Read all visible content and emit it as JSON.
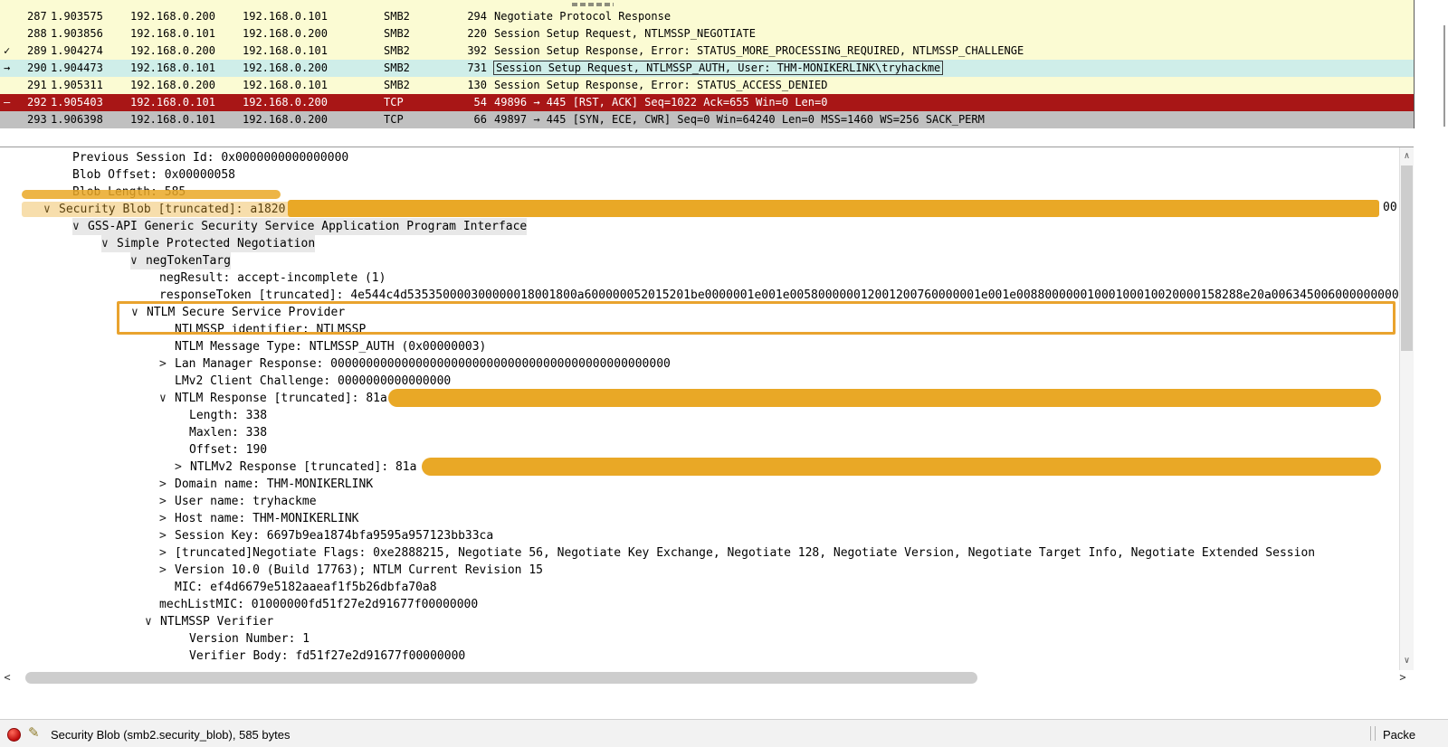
{
  "colors": {
    "row_yellow": "#fbfbd3",
    "row_teal": "#cfeee9",
    "row_red": "#a81616",
    "row_selected_gray": "#c0c0c0",
    "annotation_highlight": "#e9a826",
    "tree_highlight_gray": "#e8e8e8"
  },
  "icons": {
    "scroll_up": "∧",
    "scroll_down": "∨",
    "scroll_left": "<",
    "scroll_right": ">",
    "tree_expanded": "∨",
    "tree_collapsed": ">",
    "comment_pencil": "✎"
  },
  "packet_list": {
    "rows": [
      {
        "indicator": "",
        "no": "287",
        "time": "1.903575",
        "src": "192.168.0.200",
        "dst": "192.168.0.101",
        "proto": "SMB2",
        "len": "294",
        "info": "Negotiate Protocol Response",
        "style": "yellow",
        "info_boxed": false
      },
      {
        "indicator": "",
        "no": "288",
        "time": "1.903856",
        "src": "192.168.0.101",
        "dst": "192.168.0.200",
        "proto": "SMB2",
        "len": "220",
        "info": "Session Setup Request, NTLMSSP_NEGOTIATE",
        "style": "yellow",
        "info_boxed": false
      },
      {
        "indicator": "✓",
        "no": "289",
        "time": "1.904274",
        "src": "192.168.0.200",
        "dst": "192.168.0.101",
        "proto": "SMB2",
        "len": "392",
        "info": "Session Setup Response, Error: STATUS_MORE_PROCESSING_REQUIRED, NTLMSSP_CHALLENGE",
        "style": "yellow",
        "info_boxed": false
      },
      {
        "indicator": "→",
        "no": "290",
        "time": "1.904473",
        "src": "192.168.0.101",
        "dst": "192.168.0.200",
        "proto": "SMB2",
        "len": "731",
        "info": "Session Setup Request, NTLMSSP_AUTH, User: THM-MONIKERLINK\\tryhackme",
        "style": "teal",
        "info_boxed": true
      },
      {
        "indicator": "",
        "no": "291",
        "time": "1.905311",
        "src": "192.168.0.200",
        "dst": "192.168.0.101",
        "proto": "SMB2",
        "len": "130",
        "info": "Session Setup Response, Error: STATUS_ACCESS_DENIED",
        "style": "yellow",
        "info_boxed": false
      },
      {
        "indicator": "–",
        "no": "292",
        "time": "1.905403",
        "src": "192.168.0.101",
        "dst": "192.168.0.200",
        "proto": "TCP",
        "len": "54",
        "info": "49896 → 445 [RST, ACK] Seq=1022 Ack=655 Win=0 Len=0",
        "style": "red",
        "info_boxed": false
      },
      {
        "indicator": "",
        "no": "293",
        "time": "1.906398",
        "src": "192.168.0.101",
        "dst": "192.168.0.200",
        "proto": "TCP",
        "len": "66",
        "info": "49897 → 445 [SYN, ECE, CWR] Seq=0 Win=64240 Len=0 MSS=1460 WS=256 SACK_PERM",
        "style": "selected",
        "info_boxed": false
      }
    ]
  },
  "detail_tree": {
    "lines": [
      {
        "indent": 80,
        "arrow": "",
        "text": "Previous Session Id: 0x0000000000000000"
      },
      {
        "indent": 80,
        "arrow": "",
        "text": "Blob Offset: 0x00000058"
      },
      {
        "indent": 80,
        "arrow": "",
        "text": "Blob Length: 585"
      },
      {
        "indent": 48,
        "arrow": "v",
        "text": "Security Blob [truncated]: a1820"
      },
      {
        "indent": 80,
        "arrow": "v",
        "text": "GSS-API Generic Security Service Application Program Interface",
        "bg": true
      },
      {
        "indent": 112,
        "arrow": "v",
        "text": "Simple Protected Negotiation",
        "bg": true
      },
      {
        "indent": 144,
        "arrow": "v",
        "text": "negTokenTarg",
        "bg": true
      },
      {
        "indent": 176,
        "arrow": "",
        "text": "negResult: accept-incomplete (1)"
      },
      {
        "indent": 176,
        "arrow": "",
        "text": "responseToken [truncated]: 4e544c4d535350000300000018001800a600000052015201be0000001e001e005800000012001200760000001e001e00880000001000100010020000158288e20a00634500600000000000"
      },
      {
        "indent": 145,
        "arrow": "v",
        "text": "NTLM Secure Service Provider"
      },
      {
        "indent": 193,
        "arrow": "",
        "text": "NTLMSSP identifier: NTLMSSP"
      },
      {
        "indent": 193,
        "arrow": "",
        "text": "NTLM Message Type: NTLMSSP_AUTH (0x00000003)"
      },
      {
        "indent": 176,
        "arrow": ">",
        "text": "Lan Manager Response: 000000000000000000000000000000000000000000000000"
      },
      {
        "indent": 193,
        "arrow": "",
        "text": "LMv2 Client Challenge: 0000000000000000"
      },
      {
        "indent": 176,
        "arrow": "v",
        "text": "NTLM Response [truncated]: 81a"
      },
      {
        "indent": 209,
        "arrow": "",
        "text": "Length: 338"
      },
      {
        "indent": 209,
        "arrow": "",
        "text": "Maxlen: 338"
      },
      {
        "indent": 209,
        "arrow": "",
        "text": "Offset: 190"
      },
      {
        "indent": 193,
        "arrow": ">",
        "text": "NTLMv2 Response [truncated]: 81a"
      },
      {
        "indent": 176,
        "arrow": ">",
        "text": "Domain name: THM-MONIKERLINK"
      },
      {
        "indent": 176,
        "arrow": ">",
        "text": "User name: tryhackme"
      },
      {
        "indent": 176,
        "arrow": ">",
        "text": "Host name: THM-MONIKERLINK"
      },
      {
        "indent": 176,
        "arrow": ">",
        "text": "Session Key: 6697b9ea1874bfa9595a957123bb33ca"
      },
      {
        "indent": 176,
        "arrow": ">",
        "text": "[truncated]Negotiate Flags: 0xe2888215, Negotiate 56, Negotiate Key Exchange, Negotiate 128, Negotiate Version, Negotiate Target Info, Negotiate Extended Session"
      },
      {
        "indent": 176,
        "arrow": ">",
        "text": "Version 10.0 (Build 17763); NTLM Current Revision 15"
      },
      {
        "indent": 193,
        "arrow": "",
        "text": "MIC: ef4d6679e5182aaeaf1f5b26dbfa70a8"
      },
      {
        "indent": 176,
        "arrow": "",
        "text": "mechListMIC: 01000000fd51f27e2d91677f00000000"
      },
      {
        "indent": 160,
        "arrow": "v",
        "text": "NTLMSSP Verifier"
      },
      {
        "indent": 209,
        "arrow": "",
        "text": "Version Number: 1"
      },
      {
        "indent": 209,
        "arrow": "",
        "text": "Verifier Body: fd51f27e2d91677f00000000"
      }
    ]
  },
  "annotations": {
    "security_blob_visible_suffix": "00",
    "highlighted_field": "Security Blob",
    "boxed_field": "NTLM Secure Service Provider"
  },
  "status_bar": {
    "field_info": "Security Blob (smb2.security_blob), 585 bytes",
    "right_text": "Packe"
  }
}
